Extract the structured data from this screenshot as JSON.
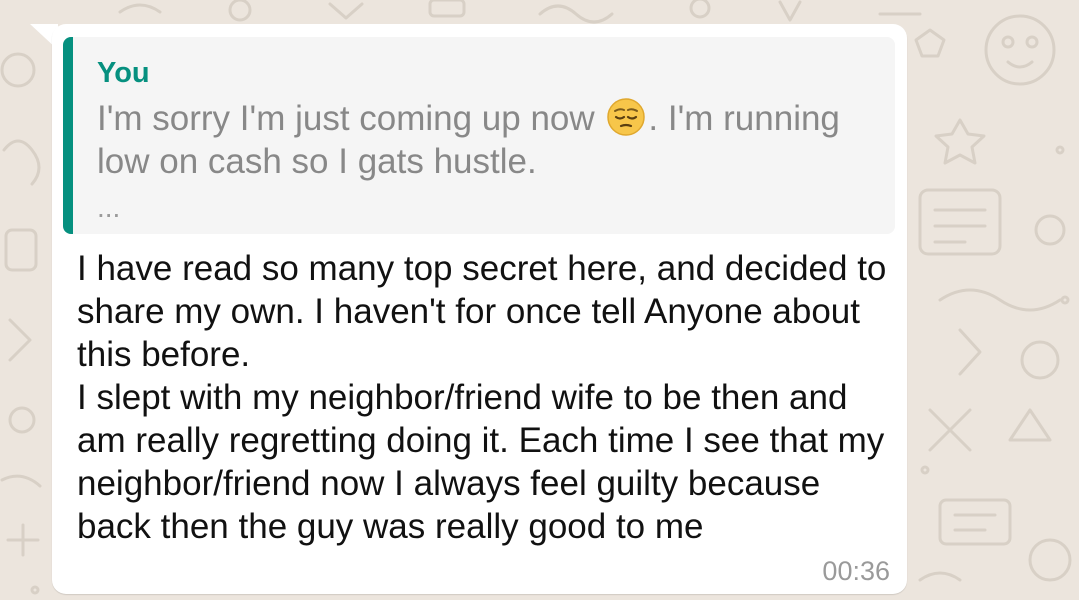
{
  "colors": {
    "chat_background": "#ece5dd",
    "bubble": "#ffffff",
    "quote_background": "#f5f5f5",
    "quote_accent": "#06907f",
    "quote_text": "#888888",
    "message_text": "#111111",
    "timestamp": "#9a9a9a"
  },
  "quoted_message": {
    "author": "You",
    "text_before_emoji": "I'm sorry I'm just coming up now ",
    "emoji": "pensive-face-emoji",
    "text_after_emoji": ". I'm running low on cash so I gats hustle.",
    "ellipsis": "..."
  },
  "message": {
    "text": "I have read so many top secret here, and decided to share my own. I haven't for once tell Anyone about this before.\nI slept with my neighbor/friend wife to be then and am really regretting doing it. Each time I see that my neighbor/friend now I always feel guilty because back then the guy was really good to me",
    "time": "00:36"
  }
}
